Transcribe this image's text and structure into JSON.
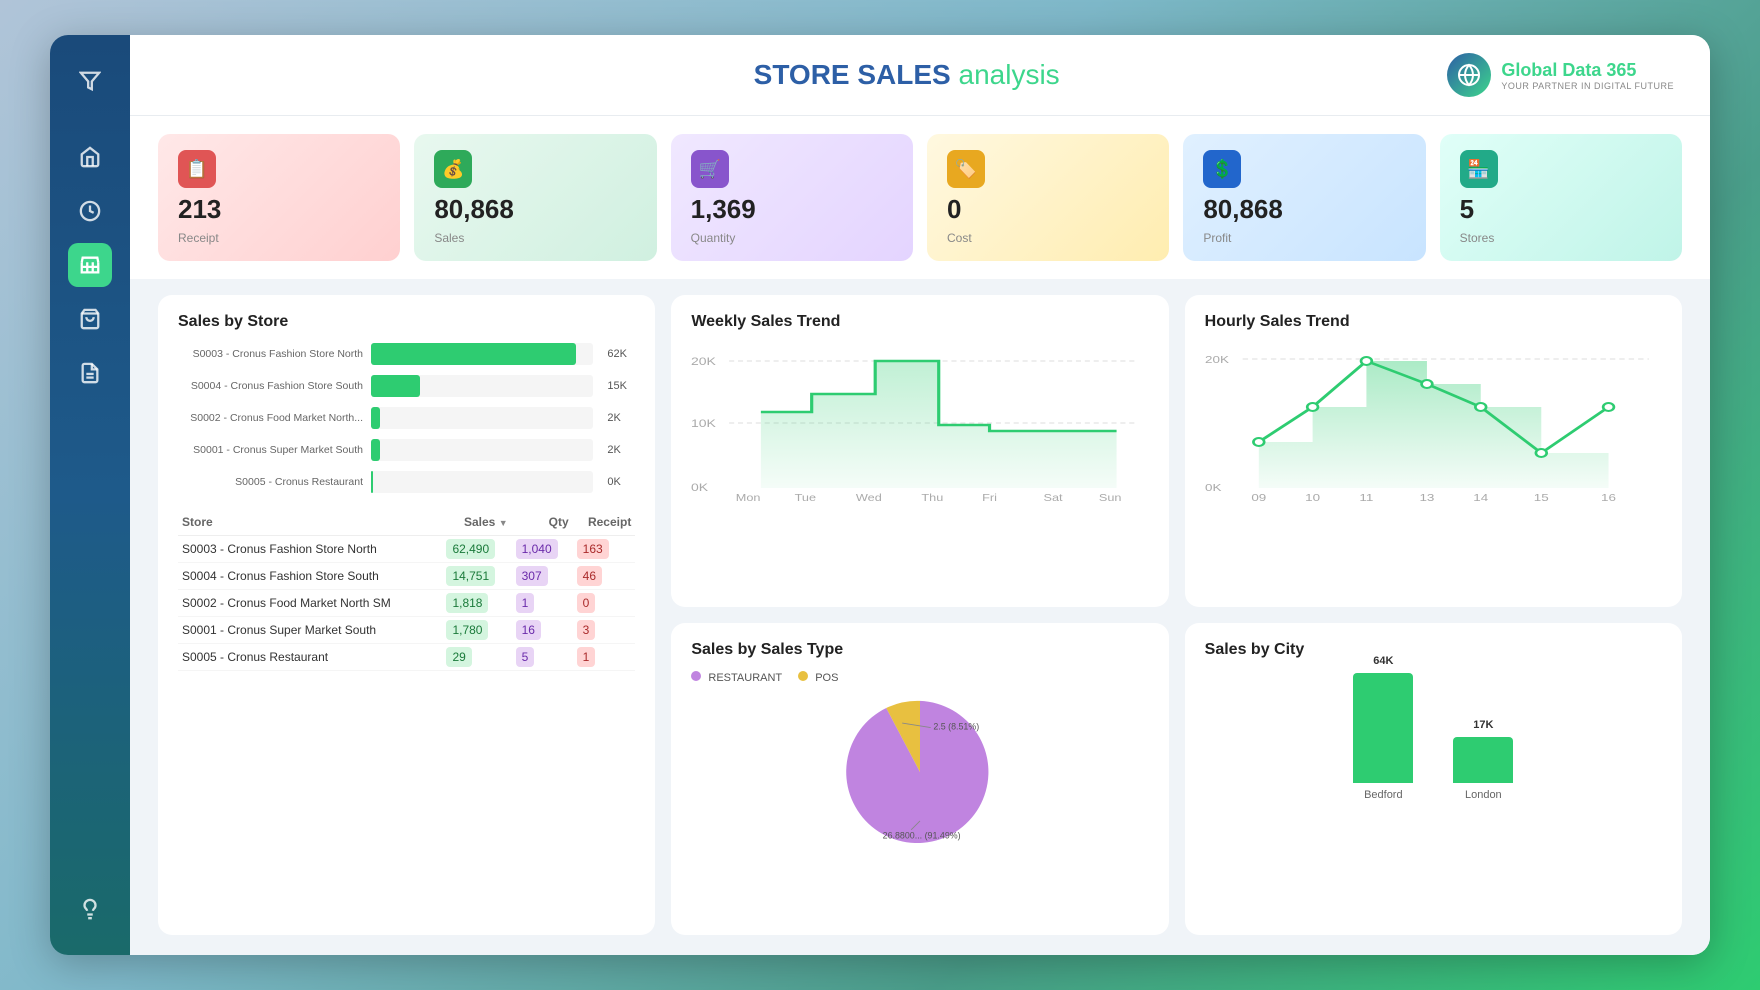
{
  "header": {
    "title_bold": "STORE SALES",
    "title_light": " analysis",
    "brand_name": "Global Data",
    "brand_num": " 365",
    "brand_tagline": "YOUR PARTNER IN DIGITAL FUTURE"
  },
  "kpis": [
    {
      "id": "receipt",
      "color": "red",
      "icon": "📋",
      "value": "213",
      "label": "Receipt"
    },
    {
      "id": "sales",
      "color": "green",
      "icon": "💰",
      "value": "80,868",
      "label": "Sales"
    },
    {
      "id": "quantity",
      "color": "purple",
      "icon": "🛒",
      "value": "1,369",
      "label": "Quantity"
    },
    {
      "id": "cost",
      "color": "yellow",
      "icon": "🏷️",
      "value": "0",
      "label": "Cost"
    },
    {
      "id": "profit",
      "color": "blue",
      "icon": "💲",
      "value": "80,868",
      "label": "Profit"
    },
    {
      "id": "stores",
      "color": "teal",
      "icon": "🏪",
      "value": "5",
      "label": "Stores"
    }
  ],
  "sales_by_store": {
    "title": "Sales by Store",
    "bars": [
      {
        "label": "S0003 - Cronus Fashion Store North",
        "pct": 92,
        "value": "62K"
      },
      {
        "label": "S0004 - Cronus Fashion Store South",
        "pct": 22,
        "value": "15K"
      },
      {
        "label": "S0002 - Cronus Food Market North...",
        "pct": 4,
        "value": "2K"
      },
      {
        "label": "S0001 - Cronus Super Market South",
        "pct": 4,
        "value": "2K"
      },
      {
        "label": "S0005 - Cronus Restaurant",
        "pct": 1,
        "value": "0K"
      }
    ],
    "table": {
      "headers": [
        "Store",
        "Sales",
        "Qty",
        "Receipt"
      ],
      "rows": [
        {
          "store": "S0003 - Cronus Fashion Store North",
          "sales": "62,490",
          "qty": "1,040",
          "receipt": "163"
        },
        {
          "store": "S0004 - Cronus Fashion Store South",
          "sales": "14,751",
          "qty": "307",
          "receipt": "46"
        },
        {
          "store": "S0002 - Cronus Food Market North SM",
          "sales": "1,818",
          "qty": "1",
          "receipt": "0"
        },
        {
          "store": "S0001 - Cronus Super Market South",
          "sales": "1,780",
          "qty": "16",
          "receipt": "3"
        },
        {
          "store": "S0005 - Cronus Restaurant",
          "sales": "29",
          "qty": "5",
          "receipt": "1"
        }
      ]
    }
  },
  "weekly_trend": {
    "title": "Weekly Sales Trend",
    "y_labels": [
      "20K",
      "10K",
      "0K"
    ],
    "x_labels": [
      "Mon",
      "Tue",
      "Wed",
      "Thu",
      "Fri",
      "Sat",
      "Sun"
    ],
    "data": [
      12,
      14,
      20,
      20,
      11,
      10,
      10
    ]
  },
  "hourly_trend": {
    "title": "Hourly Sales Trend",
    "y_labels": [
      "20K",
      "0K"
    ],
    "x_labels": [
      "09",
      "10",
      "11",
      "13",
      "14",
      "15",
      "16"
    ],
    "data": [
      8,
      14,
      22,
      18,
      14,
      6,
      14
    ]
  },
  "sales_by_type": {
    "title": "Sales by Sales Type",
    "legend": [
      {
        "label": "RESTAURANT",
        "color": "#c084e0"
      },
      {
        "label": "POS",
        "color": "#e8c040"
      }
    ],
    "slices": [
      {
        "label": "26.8800... (91.49%)",
        "value": 91.49,
        "color": "#c084e0"
      },
      {
        "label": "2.5 (8.51%)",
        "value": 8.51,
        "color": "#e8c040"
      }
    ]
  },
  "sales_by_city": {
    "title": "Sales by City",
    "bars": [
      {
        "city": "Bedford",
        "value": "64K",
        "height": 130
      },
      {
        "city": "London",
        "value": "17K",
        "height": 55
      }
    ]
  }
}
